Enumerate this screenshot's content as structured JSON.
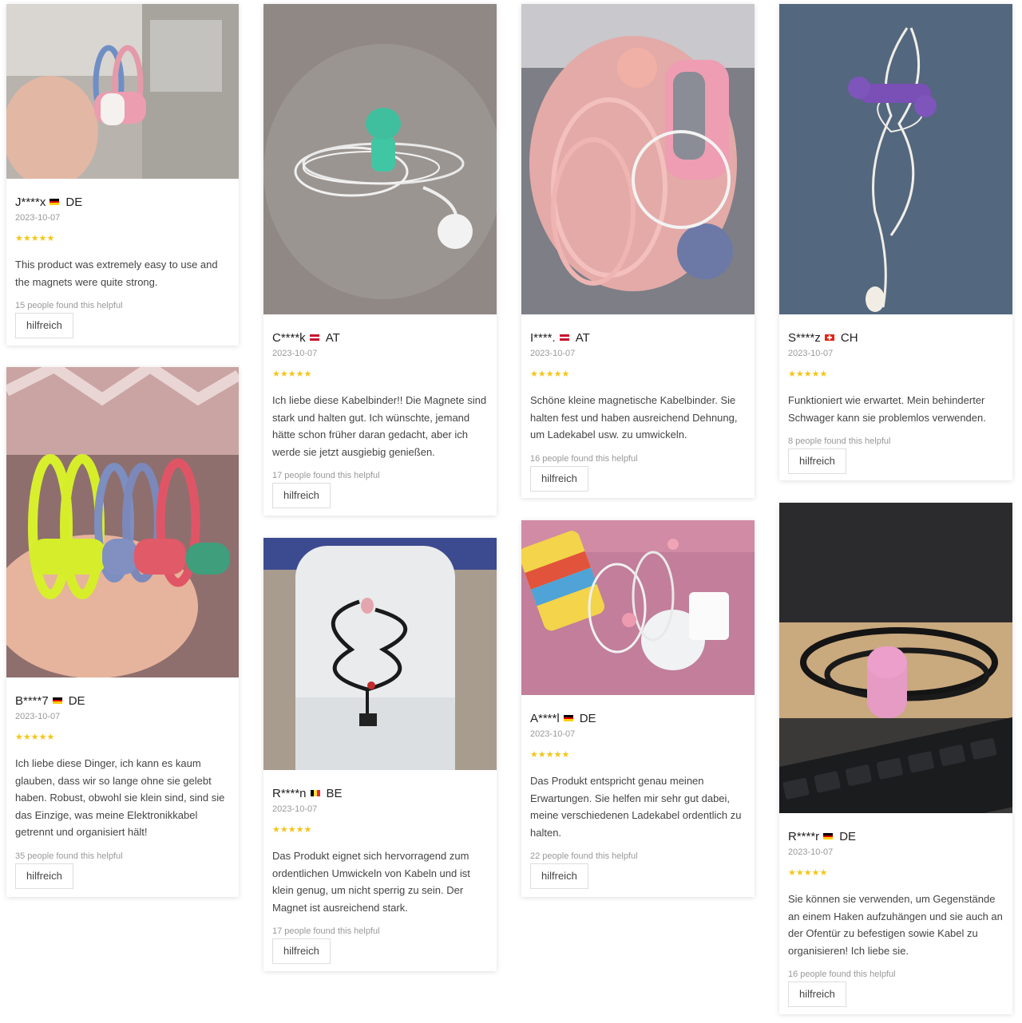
{
  "reviews": [
    {
      "author": "J****x",
      "country": "DE",
      "date": "2023-10-07",
      "stars": "★★★★★",
      "text": "This product was extremely easy to use and the magnets were quite strong.",
      "helpful_count": "15 people found this helpful",
      "helpful_button": "hilfreich",
      "image": "pastel magnetic cable ties held in hand"
    },
    {
      "author": "C****k",
      "country": "AT",
      "date": "2023-10-07",
      "stars": "★★★★★",
      "text": "Ich liebe diese Kabelbinder!! Die Magnete sind stark und halten gut. Ich wünschte, jemand hätte schon früher daran gedacht, aber ich werde sie jetzt ausgiebig genießen.",
      "helpful_count": "17 people found this helpful",
      "helpful_button": "hilfreich",
      "image": "white earphone cable with teal magnetic tie"
    },
    {
      "author": "I****.",
      "country": "AT",
      "date": "2023-10-07",
      "stars": "★★★★★",
      "text": "Schöne kleine magnetische Kabelbinder. Sie halten fest und haben ausreichend Dehnung, um Ladekabel usw. zu umwickeln.",
      "helpful_count": "16 people found this helpful",
      "helpful_button": "hilfreich",
      "image": "pink cables in a box"
    },
    {
      "author": "S****z",
      "country": "CH",
      "date": "2023-10-07",
      "stars": "★★★★★",
      "text": "Funktioniert wie erwartet. Mein behinderter Schwager kann sie problemlos verwenden.",
      "helpful_count": "8 people found this helpful",
      "helpful_button": "hilfreich",
      "image": "white earphones hanging with purple tie"
    },
    {
      "author": "B****7",
      "country": "DE",
      "date": "2023-10-07",
      "stars": "★★★★★",
      "text": "Ich liebe diese Dinger, ich kann es kaum glauben, dass wir so lange ohne sie gelebt haben. Robust, obwohl sie klein sind, sind sie das Einzige, was meine Elektronikkabel getrennt und organisiert hält!",
      "helpful_count": "35 people found this helpful",
      "helpful_button": "hilfreich",
      "image": "colorful magnetic ties in hand"
    },
    {
      "author": "R****n",
      "country": "BE",
      "date": "2023-10-07",
      "stars": "★★★★★",
      "text": "Das Produkt eignet sich hervorragend zum ordentlichen Umwickeln von Kabeln und ist klein genug, um nicht sperrig zu sein. Der Magnet ist ausreichend stark.",
      "helpful_count": "17 people found this helpful",
      "helpful_button": "hilfreich",
      "image": "black cable on white appliance"
    },
    {
      "author": "A****l",
      "country": "DE",
      "date": "2023-10-07",
      "stars": "★★★★★",
      "text": "Das Produkt entspricht genau meinen Erwartungen. Sie helfen mir sehr gut dabei, meine verschiedenen Ladekabel ordentlich zu halten.",
      "helpful_count": "22 people found this helpful",
      "helpful_button": "hilfreich",
      "image": "phone and chargers on pink cloth"
    },
    {
      "author": "R****r",
      "country": "DE",
      "date": "2023-10-07",
      "stars": "★★★★★",
      "text": "Sie können sie verwenden, um Gegenstände an einem Haken aufzuhängen und sie auch an der Ofentür zu befestigen sowie Kabel zu organisieren! Ich liebe sie.",
      "helpful_count": "16 people found this helpful",
      "helpful_button": "hilfreich",
      "image": "black cable with pink tie over keyboard"
    }
  ]
}
